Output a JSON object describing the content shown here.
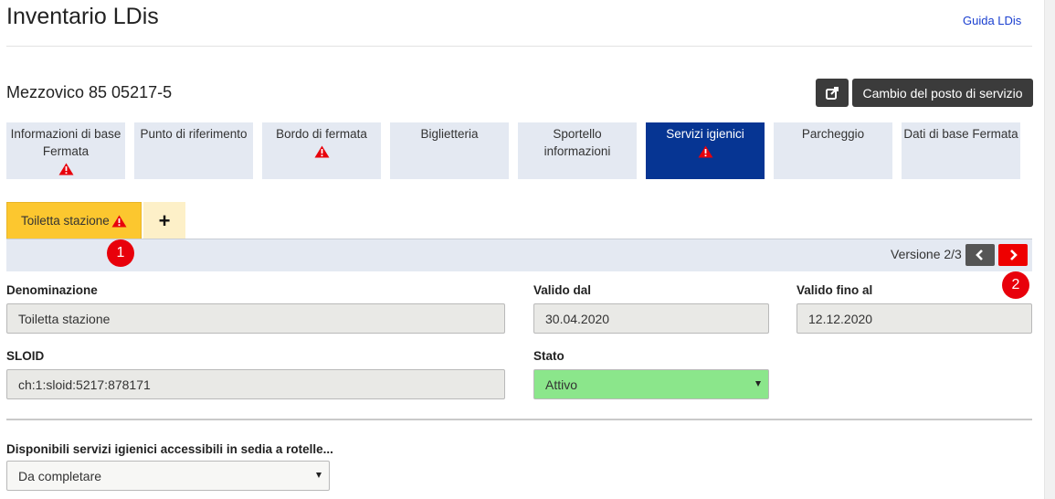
{
  "app": {
    "title": "Inventario LDis",
    "help_link": "Guida LDis"
  },
  "location": {
    "name": "Mezzovico 85 05217-5"
  },
  "header_buttons": {
    "icon": "external-link-icon",
    "change_label": "Cambio del posto di servizio"
  },
  "main_tabs": [
    {
      "line1": "Informazioni di base",
      "line2": "Fermata",
      "warning": true
    },
    {
      "line1": "Punto di riferimento",
      "line2": "",
      "warning": false
    },
    {
      "line1": "Bordo di fermata",
      "line2": "",
      "warning": true
    },
    {
      "line1": "Biglietteria",
      "line2": "",
      "warning": false
    },
    {
      "line1": "Sportello",
      "line2": "informazioni",
      "warning": false
    },
    {
      "line1": "Servizi igienici",
      "line2": "",
      "warning": true
    },
    {
      "line1": "Parcheggio",
      "line2": "",
      "warning": false
    },
    {
      "line1": "Dati di base Fermata",
      "line2": "",
      "warning": false
    }
  ],
  "sub_tabs": {
    "active": "Toiletta stazione",
    "add": "+"
  },
  "version_bar": {
    "label": "Versione 2/3"
  },
  "form": {
    "denominazione": {
      "label": "Denominazione",
      "value": "Toiletta stazione"
    },
    "valido_dal": {
      "label": "Valido dal",
      "value": "30.04.2020"
    },
    "valido_fino": {
      "label": "Valido fino al",
      "value": "12.12.2020"
    },
    "sloid": {
      "label": "SLOID",
      "value": "ch:1:sloid:5217:878171"
    },
    "stato": {
      "label": "Stato",
      "value": "Attivo"
    },
    "accessibili": {
      "label": "Disponibili servizi igienici accessibili in sedia a rotelle...",
      "value": "Da completare"
    }
  },
  "annotations": {
    "one": "1",
    "two": "2"
  },
  "colors": {
    "active_tab": "#063593",
    "tab_bg": "#e4e9f2",
    "subtab_active": "#fcc72f",
    "next_button": "#ee0000",
    "status_green": "#8be68b",
    "warning": "#e8000b"
  }
}
